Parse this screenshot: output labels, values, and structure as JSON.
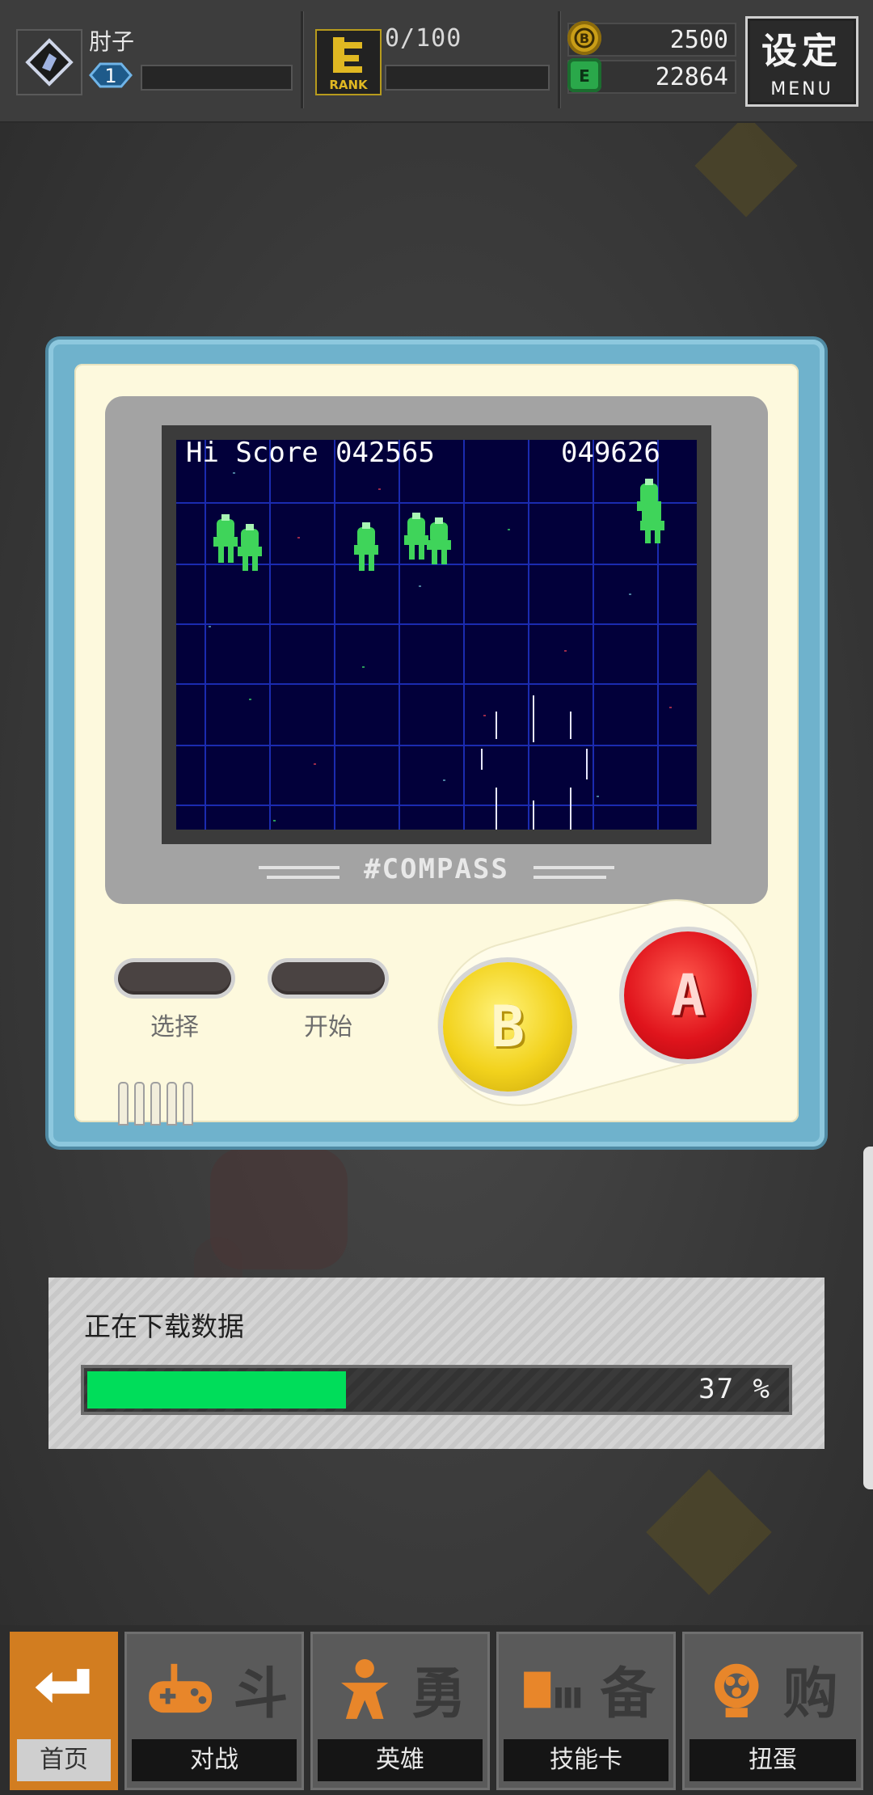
{
  "header": {
    "player_name": "肘子",
    "player_level": "1",
    "rank_count": "0/100",
    "rank_icon_text": "RANK",
    "currency_gold": "2500",
    "currency_green": "22864",
    "menu_kanji": "设定",
    "menu_label": "MENU"
  },
  "game_screen": {
    "hiscore_label": "Hi Score",
    "hiscore_value": "042565",
    "score_value": "049626",
    "brand": "#COMPASS"
  },
  "console_controls": {
    "select_label": "选择",
    "start_label": "开始",
    "button_b": "B",
    "button_a": "A"
  },
  "download": {
    "title": "正在下载数据",
    "progress_percent": 37,
    "progress_text": "37 %"
  },
  "bottom_nav": {
    "items": [
      {
        "label": "首页",
        "icon": "return-arrow-icon",
        "art_text": "",
        "active": true
      },
      {
        "label": "对战",
        "icon": "gamepad-icon",
        "art_text": "斗",
        "active": false
      },
      {
        "label": "英雄",
        "icon": "hero-figure-icon",
        "art_text": "勇",
        "active": false
      },
      {
        "label": "技能卡",
        "icon": "card-stack-icon",
        "art_text": "备",
        "active": false
      },
      {
        "label": "扭蛋",
        "icon": "gacha-capsule-icon",
        "art_text": "购",
        "active": false
      }
    ]
  },
  "colors": {
    "progress_fill": "#00dd5a",
    "console_border": "#6fb2cc",
    "console_body": "#fdf9dd",
    "button_a": "#e0141c",
    "button_b": "#f2d21c",
    "nav_active": "#d27d20",
    "lcd_background": "#02003a",
    "enemy_green": "#3fd45a"
  }
}
